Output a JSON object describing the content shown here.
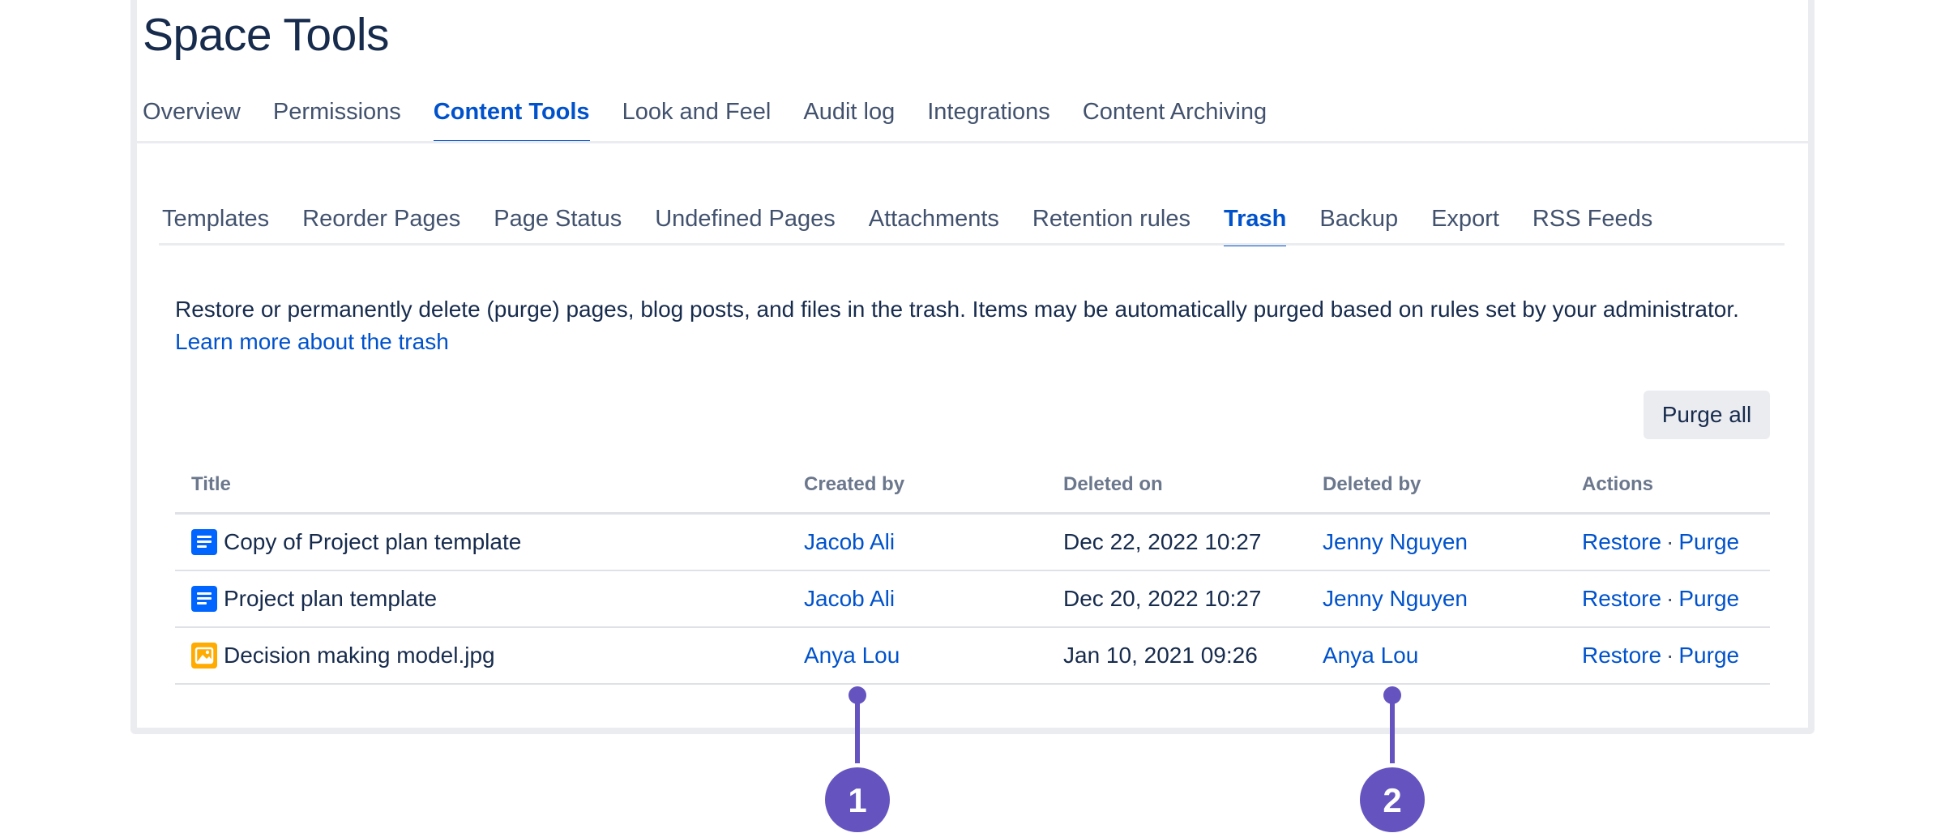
{
  "page_title": "Space Tools",
  "main_tabs": [
    "Overview",
    "Permissions",
    "Content Tools",
    "Look and Feel",
    "Audit log",
    "Integrations",
    "Content Archiving"
  ],
  "sub_tabs": [
    "Templates",
    "Reorder Pages",
    "Page Status",
    "Undefined Pages",
    "Attachments",
    "Retention rules",
    "Trash",
    "Backup",
    "Export",
    "RSS Feeds"
  ],
  "description": {
    "text": "Restore or permanently delete (purge) pages, blog posts, and files in the trash. Items may be automatically purged based on rules set by your administrator.",
    "link": "Learn more about the trash"
  },
  "purge_all_label": "Purge all",
  "table": {
    "headers": [
      "Title",
      "Created by",
      "Deleted on",
      "Deleted by",
      "Actions"
    ],
    "rows": [
      {
        "icon": "page-icon",
        "title": "Copy of Project plan template",
        "created_by": "Jacob Ali",
        "deleted_on": "Dec 22, 2022 10:27",
        "deleted_by": "Jenny Nguyen",
        "restore": "Restore",
        "sep": "·",
        "purge": "Purge"
      },
      {
        "icon": "page-icon",
        "title": "Project plan template",
        "created_by": "Jacob Ali",
        "deleted_on": "Dec 20, 2022 10:27",
        "deleted_by": "Jenny Nguyen",
        "restore": "Restore",
        "sep": "·",
        "purge": "Purge"
      },
      {
        "icon": "image-icon",
        "title": "Decision making model.jpg",
        "created_by": "Anya Lou",
        "deleted_on": "Jan 10, 2021 09:26",
        "deleted_by": "Anya Lou",
        "restore": "Restore",
        "sep": "·",
        "purge": "Purge"
      }
    ]
  },
  "callouts": [
    "1",
    "2"
  ],
  "colors": {
    "accent": "#0052cc",
    "callout": "#6554c0",
    "page_icon": "#0065ff",
    "image_icon": "#ffab00"
  }
}
